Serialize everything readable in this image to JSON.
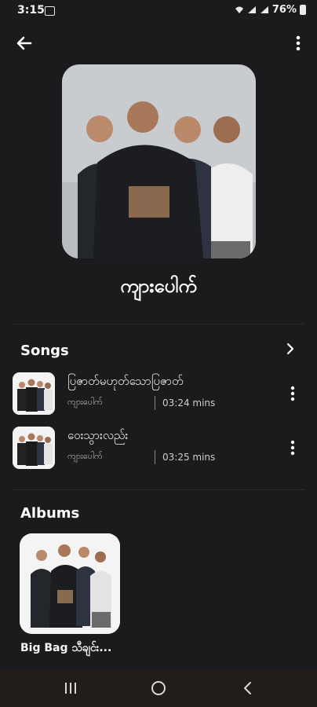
{
  "status_bar": {
    "time": "3:15",
    "battery": "76%"
  },
  "artist": {
    "name": "ကျားပေါက်"
  },
  "songs_section": {
    "title": "Songs",
    "items": [
      {
        "title": "ပြဇာတ်မဟုတ်သောပြဇာတ်",
        "artist": "ကျားပေါက်",
        "duration": "03:24 mins"
      },
      {
        "title": "ဝေးသွားလည်း",
        "artist": "ကျားပေါက်",
        "duration": "03:25 mins"
      }
    ]
  },
  "albums_section": {
    "title": "Albums",
    "items": [
      {
        "title": "Big Bag သီချင်း..."
      }
    ]
  },
  "icons": {
    "back": "arrow-left-icon",
    "more": "more-vertical-icon",
    "chevron": "chevron-right-icon",
    "nav_recents": "recents-icon",
    "nav_home": "home-circle-icon",
    "nav_back": "back-chevron-icon"
  },
  "colors": {
    "background": "#1b1b1d",
    "navbar": "#221d1b",
    "text": "#ffffff"
  }
}
